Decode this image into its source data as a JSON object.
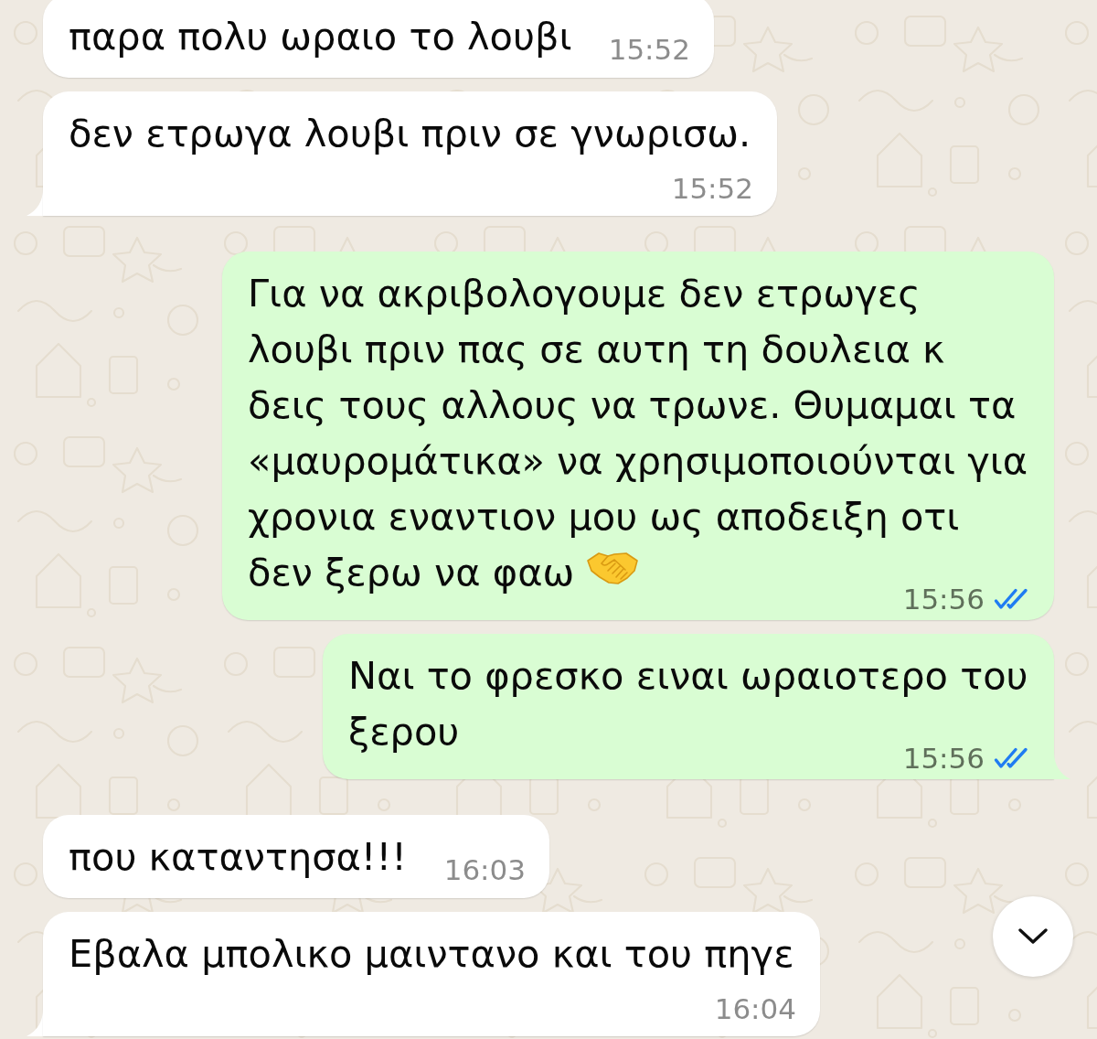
{
  "chat": {
    "messages": [
      {
        "kind": "incoming",
        "text": "παρα πολυ ωραιο το λουβι",
        "time": "15:52"
      },
      {
        "kind": "incoming",
        "text": "δεν ετρωγα λουβι πριν σε γνωρισω.",
        "time": "15:52"
      },
      {
        "kind": "outgoing",
        "text": "Για να ακριβολογουμε δεν ετρωγες λουβι πριν πας σε αυτη τη δουλεια κ δεις τους αλλους να τρωνε. Θυμαμαι τα «μαυρομάτικα» να χρησιμοποιούνται για χρονια εναντιον μου ως αποδειξη οτι δεν ξερω να φαω",
        "trailing_emoji": true,
        "time": "15:56",
        "read": true
      },
      {
        "kind": "outgoing",
        "text": "Ναι το φρεσκο ειναι ωραιοτερο του ξερου",
        "time": "15:56",
        "read": true
      },
      {
        "kind": "incoming",
        "text": "που καταντησα!!!",
        "time": "16:03"
      },
      {
        "kind": "incoming",
        "text": "Εβαλα μπολικο μαιντανο και του πηγε",
        "time": "16:04"
      }
    ]
  }
}
